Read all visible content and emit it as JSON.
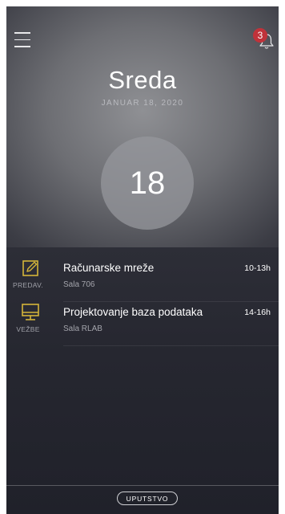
{
  "header": {
    "notifications_count": "3",
    "menu_icon": "hamburger-icon",
    "bell_icon": "bell-icon"
  },
  "date": {
    "day_name": "Sreda",
    "full_date": "JANUAR 18, 2020",
    "day_number": "18"
  },
  "classes": [
    {
      "kind": "PREDAV.",
      "icon": "edit-icon",
      "title": "Računarske mreže",
      "room": "Sala 706",
      "time": "10-13h"
    },
    {
      "kind": "VEŽBE",
      "icon": "monitor-icon",
      "title": "Projektovanje baza podataka",
      "room": "Sala RLAB",
      "time": "14-16h"
    }
  ],
  "footer": {
    "guide_label": "UPUTSTVO"
  },
  "colors": {
    "accent_icon": "#d4b53a",
    "badge": "#c0323a"
  }
}
